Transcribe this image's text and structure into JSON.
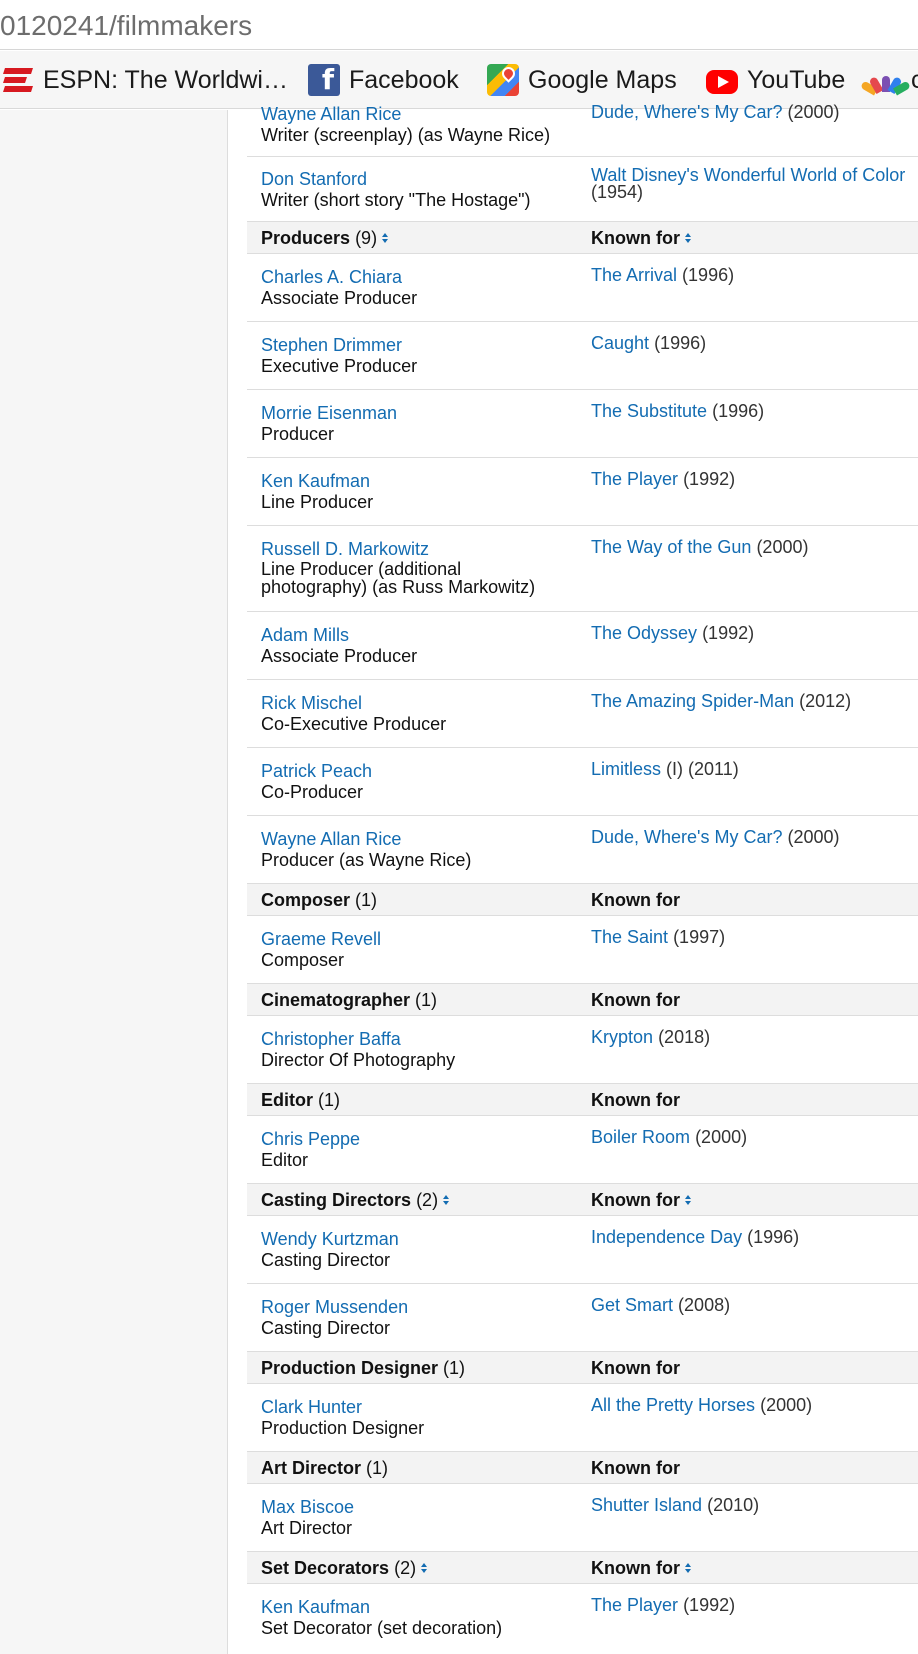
{
  "browser": {
    "url": "0120241/filmmakers",
    "bookmarks": [
      {
        "label": "ESPN: The Worldwi…",
        "icon": "espn-icon"
      },
      {
        "label": "Facebook",
        "icon": "facebook-icon"
      },
      {
        "label": "Google Maps",
        "icon": "google-maps-icon"
      },
      {
        "label": "YouTube",
        "icon": "youtube-icon"
      },
      {
        "label": "c",
        "icon": "nbc-icon"
      }
    ]
  },
  "writers_tail": [
    {
      "name": "Wayne Allan Rice",
      "role": "Writer (screenplay) (as Wayne Rice)",
      "title": "Dude, Where's My Car?",
      "year": "(2000)"
    },
    {
      "name": "Don Stanford",
      "role": "Writer (short story \"The Hostage\")",
      "title": "Walt Disney's Wonderful World of Color",
      "year": "(1954)"
    }
  ],
  "producers": {
    "label": "Producers",
    "count": "(9)",
    "known_for": "Known for",
    "rows": [
      {
        "name": "Charles A. Chiara",
        "role": "Associate Producer",
        "title": "The Arrival",
        "year": "(1996)"
      },
      {
        "name": "Stephen Drimmer",
        "role": "Executive Producer",
        "title": "Caught",
        "year": "(1996)"
      },
      {
        "name": "Morrie Eisenman",
        "role": "Producer",
        "title": "The Substitute",
        "year": "(1996)"
      },
      {
        "name": "Ken Kaufman",
        "role": "Line Producer",
        "title": "The Player",
        "year": "(1992)"
      },
      {
        "name": "Russell D. Markowitz",
        "role": "Line Producer (additional photography) (as Russ Markowitz)",
        "title": "The Way of the Gun",
        "year": "(2000)"
      },
      {
        "name": "Adam Mills",
        "role": "Associate Producer",
        "title": "The Odyssey",
        "year": "(1992)"
      },
      {
        "name": "Rick Mischel",
        "role": "Co-Executive Producer",
        "title": "The Amazing Spider-Man",
        "year": "(2012)"
      },
      {
        "name": "Patrick Peach",
        "role": "Co-Producer",
        "title": "Limitless",
        "year": "(I) (2011)"
      },
      {
        "name": "Wayne Allan Rice",
        "role": "Producer (as Wayne Rice)",
        "title": "Dude, Where's My Car?",
        "year": "(2000)"
      }
    ]
  },
  "composer": {
    "label": "Composer",
    "count": "(1)",
    "known_for": "Known for",
    "rows": [
      {
        "name": "Graeme Revell",
        "role": "Composer",
        "title": "The Saint",
        "year": "(1997)"
      }
    ]
  },
  "cinematographer": {
    "label": "Cinematographer",
    "count": "(1)",
    "known_for": "Known for",
    "rows": [
      {
        "name": "Christopher Baffa",
        "role": "Director Of Photography",
        "title": "Krypton",
        "year": "(2018)"
      }
    ]
  },
  "editor": {
    "label": "Editor",
    "count": "(1)",
    "known_for": "Known for",
    "rows": [
      {
        "name": "Chris Peppe",
        "role": "Editor",
        "title": "Boiler Room",
        "year": "(2000)"
      }
    ]
  },
  "casting": {
    "label": "Casting Directors",
    "count": "(2)",
    "known_for": "Known for",
    "rows": [
      {
        "name": "Wendy Kurtzman",
        "role": "Casting Director",
        "title": "Independence Day",
        "year": "(1996)"
      },
      {
        "name": "Roger Mussenden",
        "role": "Casting Director",
        "title": "Get Smart",
        "year": "(2008)"
      }
    ]
  },
  "production_designer": {
    "label": "Production Designer",
    "count": "(1)",
    "known_for": "Known for",
    "rows": [
      {
        "name": "Clark Hunter",
        "role": "Production Designer",
        "title": "All the Pretty Horses",
        "year": "(2000)"
      }
    ]
  },
  "art_director": {
    "label": "Art Director",
    "count": "(1)",
    "known_for": "Known for",
    "rows": [
      {
        "name": "Max Biscoe",
        "role": "Art Director",
        "title": "Shutter Island",
        "year": "(2010)"
      }
    ]
  },
  "set_decorators": {
    "label": "Set Decorators",
    "count": "(2)",
    "known_for": "Known for",
    "rows": [
      {
        "name": "Ken Kaufman",
        "role": "Set Decorator (set decoration)",
        "title": "The Player",
        "year": "(1992)"
      }
    ]
  },
  "colors": {
    "link": "#136cb2",
    "header_bg": "#f3f3f3",
    "sidebar_bg": "#f6f6f6"
  }
}
